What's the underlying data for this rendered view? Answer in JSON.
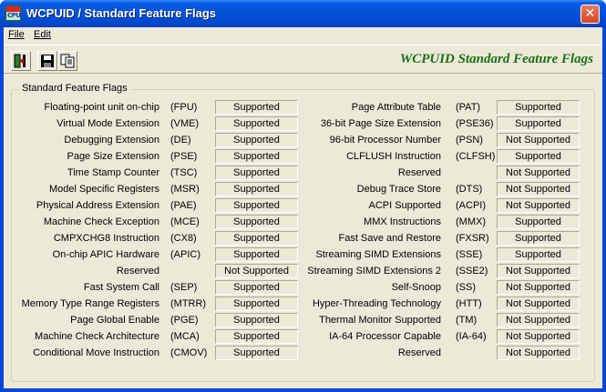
{
  "window": {
    "title": "WCPUID / Standard Feature Flags",
    "app_icon_text": "CPU",
    "close_symbol": "✕"
  },
  "menu": {
    "file": "File",
    "edit": "Edit"
  },
  "toolbar": {
    "banner": "WCPUID  Standard Feature Flags"
  },
  "group": {
    "label": "Standard Feature Flags"
  },
  "left_features": [
    {
      "label": "Floating-point unit on-chip",
      "abbr": "(FPU)",
      "status": "Supported"
    },
    {
      "label": "Virtual Mode Extension",
      "abbr": "(VME)",
      "status": "Supported"
    },
    {
      "label": "Debugging Extension",
      "abbr": "(DE)",
      "status": "Supported"
    },
    {
      "label": "Page Size Extension",
      "abbr": "(PSE)",
      "status": "Supported"
    },
    {
      "label": "Time Stamp Counter",
      "abbr": "(TSC)",
      "status": "Supported"
    },
    {
      "label": "Model Specific Registers",
      "abbr": "(MSR)",
      "status": "Supported"
    },
    {
      "label": "Physical Address Extension",
      "abbr": "(PAE)",
      "status": "Supported"
    },
    {
      "label": "Machine Check Exception",
      "abbr": "(MCE)",
      "status": "Supported"
    },
    {
      "label": "CMPXCHG8 Instruction",
      "abbr": "(CX8)",
      "status": "Supported"
    },
    {
      "label": "On-chip APIC Hardware",
      "abbr": "(APIC)",
      "status": "Supported"
    },
    {
      "label": "Reserved",
      "abbr": "",
      "status": "Not Supported"
    },
    {
      "label": "Fast System Call",
      "abbr": "(SEP)",
      "status": "Supported"
    },
    {
      "label": "Memory Type Range Registers",
      "abbr": "(MTRR)",
      "status": "Supported"
    },
    {
      "label": "Page Global Enable",
      "abbr": "(PGE)",
      "status": "Supported"
    },
    {
      "label": "Machine Check Architecture",
      "abbr": "(MCA)",
      "status": "Supported"
    },
    {
      "label": "Conditional Move Instruction",
      "abbr": "(CMOV)",
      "status": "Supported"
    }
  ],
  "right_features": [
    {
      "label": "Page Attribute Table",
      "abbr": "(PAT)",
      "status": "Supported"
    },
    {
      "label": "36-bit Page Size Extension",
      "abbr": "(PSE36)",
      "status": "Supported"
    },
    {
      "label": "96-bit Processor Number",
      "abbr": "(PSN)",
      "status": "Not Supported"
    },
    {
      "label": "CLFLUSH Instruction",
      "abbr": "(CLFSH)",
      "status": "Supported"
    },
    {
      "label": "Reserved",
      "abbr": "",
      "status": "Not Supported"
    },
    {
      "label": "Debug Trace Store",
      "abbr": "(DTS)",
      "status": "Not Supported"
    },
    {
      "label": "ACPI Supported",
      "abbr": "(ACPI)",
      "status": "Not Supported"
    },
    {
      "label": "MMX Instructions",
      "abbr": "(MMX)",
      "status": "Supported"
    },
    {
      "label": "Fast Save and Restore",
      "abbr": "(FXSR)",
      "status": "Supported"
    },
    {
      "label": "Streaming SIMD Extensions",
      "abbr": "(SSE)",
      "status": "Supported"
    },
    {
      "label": "Streaming SIMD Extensions 2",
      "abbr": "(SSE2)",
      "status": "Not Supported"
    },
    {
      "label": "Self-Snoop",
      "abbr": "(SS)",
      "status": "Not Supported"
    },
    {
      "label": "Hyper-Threading Technology",
      "abbr": "(HTT)",
      "status": "Not Supported"
    },
    {
      "label": "Thermal Monitor Supported",
      "abbr": "(TM)",
      "status": "Not Supported"
    },
    {
      "label": "IA-64 Processor Capable",
      "abbr": "(IA-64)",
      "status": "Not Supported"
    },
    {
      "label": "Reserved",
      "abbr": "",
      "status": "Not Supported"
    }
  ]
}
